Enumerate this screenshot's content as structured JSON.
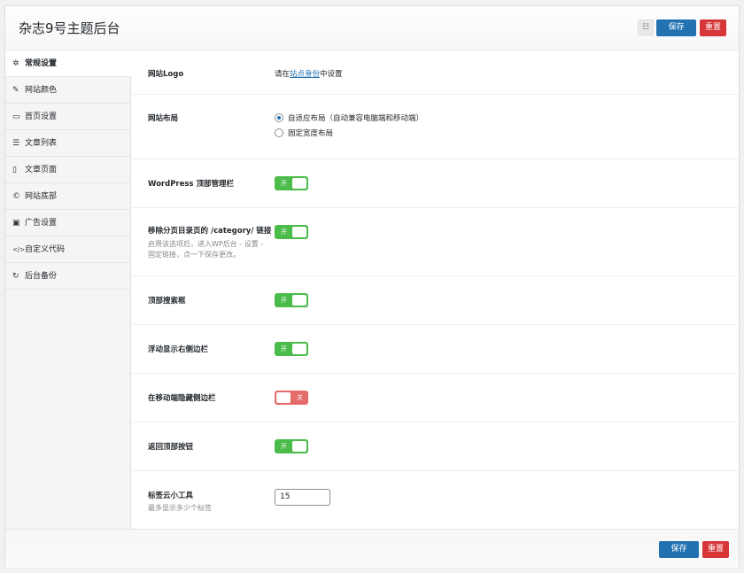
{
  "header": {
    "title": "杂志9号主题后台",
    "save_label": "保存",
    "reset_label": "重置",
    "icon_glyph": "☷"
  },
  "sidebar": {
    "items": [
      {
        "label": "常规设置",
        "icon": "gear-icon",
        "glyph": "✲"
      },
      {
        "label": "网站颜色",
        "icon": "brush-icon",
        "glyph": "✎"
      },
      {
        "label": "首页设置",
        "icon": "monitor-icon",
        "glyph": "▭"
      },
      {
        "label": "文章列表",
        "icon": "list-icon",
        "glyph": "☰"
      },
      {
        "label": "文章页面",
        "icon": "file-icon",
        "glyph": "▯"
      },
      {
        "label": "网站底部",
        "icon": "copyright-icon",
        "glyph": "©"
      },
      {
        "label": "广告设置",
        "icon": "ad-icon",
        "glyph": "▣"
      },
      {
        "label": "自定义代码",
        "icon": "code-icon",
        "glyph": "</>"
      },
      {
        "label": "后台备份",
        "icon": "refresh-icon",
        "glyph": "↻"
      }
    ]
  },
  "settings": {
    "logo": {
      "label": "网站Logo",
      "pre": "请在",
      "link": "站点身份",
      "post": "中设置"
    },
    "layout": {
      "label": "网站布局",
      "option1": "自适应布局（自动兼容电脑端和移动端）",
      "option2": "固定宽度布局"
    },
    "admin_bar": {
      "label": "WordPress 顶部管理栏",
      "state": "开"
    },
    "category": {
      "label": "移除分页目录页的 /category/ 链接",
      "desc": "启用该选项后，进入WP后台 - 设置 - 固定链接，点一下保存更改。",
      "state": "开"
    },
    "search": {
      "label": "顶部搜索框",
      "state": "开"
    },
    "float_sidebar": {
      "label": "浮动显示右侧边栏",
      "state": "开"
    },
    "mobile_hide": {
      "label": "在移动端隐藏侧边栏",
      "state": "关"
    },
    "back_top": {
      "label": "返回顶部按钮",
      "state": "开"
    },
    "tag_cloud": {
      "label": "标签云小工具",
      "desc": "最多显示多少个标签",
      "value": "15"
    }
  },
  "footer": {
    "save_label": "保存",
    "reset_label": "重置"
  }
}
